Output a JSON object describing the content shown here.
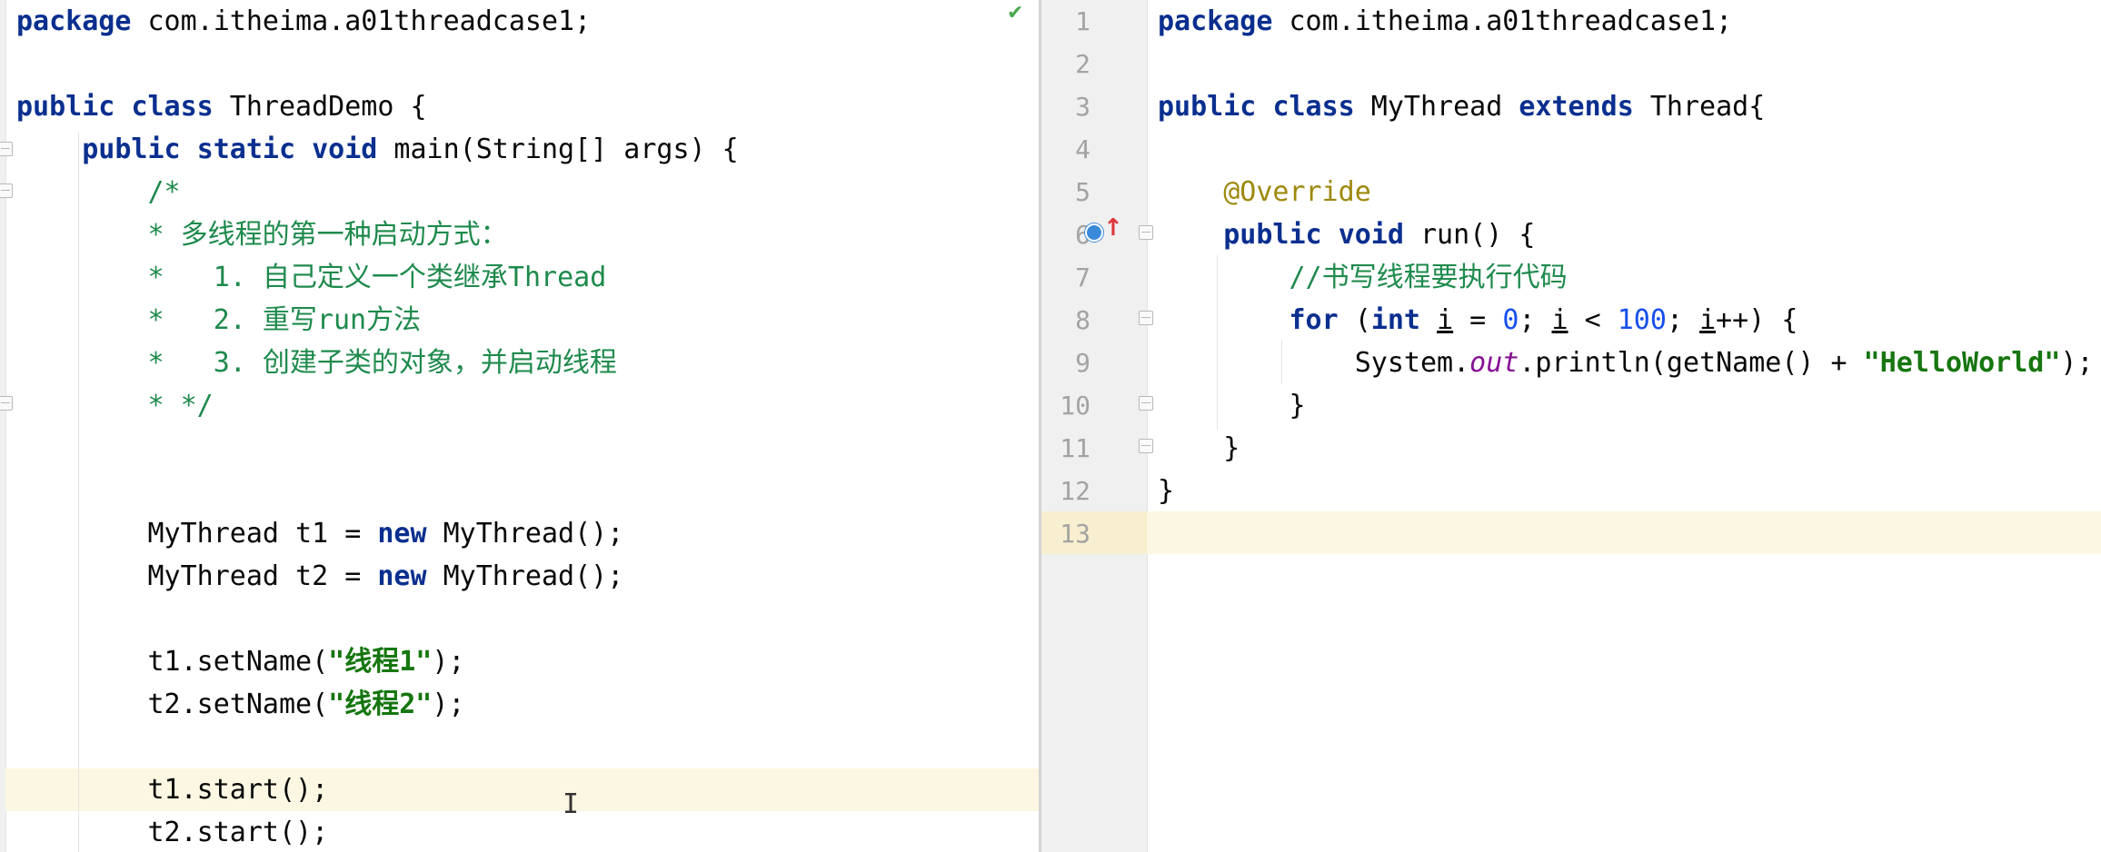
{
  "left_editor": {
    "status_icon": "check-icon",
    "lines": [
      {
        "parts": [
          {
            "t": "package",
            "c": "kw"
          },
          {
            "t": " com.itheima.a01threadcase1;"
          }
        ]
      },
      {
        "parts": []
      },
      {
        "parts": [
          {
            "t": "public",
            "c": "kw"
          },
          {
            "t": " "
          },
          {
            "t": "class",
            "c": "kw"
          },
          {
            "t": " ThreadDemo {"
          }
        ]
      },
      {
        "parts": [
          {
            "t": "    "
          },
          {
            "t": "public",
            "c": "kw"
          },
          {
            "t": " "
          },
          {
            "t": "static",
            "c": "kw"
          },
          {
            "t": " "
          },
          {
            "t": "void",
            "c": "kw"
          },
          {
            "t": " main(String[] args) {"
          }
        ]
      },
      {
        "parts": [
          {
            "t": "        "
          },
          {
            "t": "/*",
            "c": "cm"
          }
        ]
      },
      {
        "parts": [
          {
            "t": "        "
          },
          {
            "t": "* 多线程的第一种启动方式：",
            "c": "cm"
          }
        ]
      },
      {
        "parts": [
          {
            "t": "        "
          },
          {
            "t": "*   1. 自己定义一个类继承Thread",
            "c": "cm"
          }
        ]
      },
      {
        "parts": [
          {
            "t": "        "
          },
          {
            "t": "*   2. 重写run方法",
            "c": "cm"
          }
        ]
      },
      {
        "parts": [
          {
            "t": "        "
          },
          {
            "t": "*   3. 创建子类的对象，并启动线程",
            "c": "cm"
          }
        ]
      },
      {
        "parts": [
          {
            "t": "        "
          },
          {
            "t": "* */",
            "c": "cm"
          }
        ]
      },
      {
        "parts": []
      },
      {
        "parts": []
      },
      {
        "parts": [
          {
            "t": "        MyThread t1 = "
          },
          {
            "t": "new",
            "c": "kw"
          },
          {
            "t": " MyThread();"
          }
        ]
      },
      {
        "parts": [
          {
            "t": "        MyThread t2 = "
          },
          {
            "t": "new",
            "c": "kw"
          },
          {
            "t": " MyThread();"
          }
        ]
      },
      {
        "parts": []
      },
      {
        "parts": [
          {
            "t": "        t1.setName("
          },
          {
            "t": "\"线程1\"",
            "c": "str"
          },
          {
            "t": ");"
          }
        ]
      },
      {
        "parts": [
          {
            "t": "        t2.setName("
          },
          {
            "t": "\"线程2\"",
            "c": "str"
          },
          {
            "t": ");"
          }
        ]
      },
      {
        "parts": []
      },
      {
        "parts": [
          {
            "t": "        t1.start();"
          }
        ]
      },
      {
        "parts": [
          {
            "t": "        t2.start();"
          }
        ]
      }
    ]
  },
  "right_editor": {
    "line_numbers": [
      "1",
      "2",
      "3",
      "4",
      "5",
      "6",
      "7",
      "8",
      "9",
      "10",
      "11",
      "12",
      "13"
    ],
    "gutter_icons": [
      "override-method-icon"
    ],
    "lines": [
      {
        "parts": [
          {
            "t": "package",
            "c": "kw"
          },
          {
            "t": " com.itheima.a01threadcase1;"
          }
        ]
      },
      {
        "parts": []
      },
      {
        "parts": [
          {
            "t": "public",
            "c": "kw"
          },
          {
            "t": " "
          },
          {
            "t": "class",
            "c": "kw"
          },
          {
            "t": " MyThread "
          },
          {
            "t": "extends",
            "c": "kw"
          },
          {
            "t": " Thread{"
          }
        ]
      },
      {
        "parts": []
      },
      {
        "parts": [
          {
            "t": "    "
          },
          {
            "t": "@Override",
            "c": "ann"
          }
        ]
      },
      {
        "parts": [
          {
            "t": "    "
          },
          {
            "t": "public",
            "c": "kw"
          },
          {
            "t": " "
          },
          {
            "t": "void",
            "c": "kw"
          },
          {
            "t": " run() {"
          }
        ]
      },
      {
        "parts": [
          {
            "t": "        "
          },
          {
            "t": "//书写线程要执行代码",
            "c": "cm"
          }
        ]
      },
      {
        "parts": [
          {
            "t": "        "
          },
          {
            "t": "for",
            "c": "kw"
          },
          {
            "t": " ("
          },
          {
            "t": "int",
            "c": "kw"
          },
          {
            "t": " "
          },
          {
            "t": "i",
            "c": "ul"
          },
          {
            "t": " = "
          },
          {
            "t": "0",
            "c": "num"
          },
          {
            "t": "; "
          },
          {
            "t": "i",
            "c": "ul"
          },
          {
            "t": " < "
          },
          {
            "t": "100",
            "c": "num"
          },
          {
            "t": "; "
          },
          {
            "t": "i",
            "c": "ul"
          },
          {
            "t": "++) {"
          }
        ]
      },
      {
        "parts": [
          {
            "t": "            System."
          },
          {
            "t": "out",
            "c": "fld"
          },
          {
            "t": ".println(getName() + "
          },
          {
            "t": "\"HelloWorld\"",
            "c": "str"
          },
          {
            "t": ");"
          }
        ]
      },
      {
        "parts": [
          {
            "t": "        }"
          }
        ]
      },
      {
        "parts": [
          {
            "t": "    }"
          }
        ]
      },
      {
        "parts": [
          {
            "t": "}"
          }
        ]
      },
      {
        "parts": []
      }
    ]
  }
}
